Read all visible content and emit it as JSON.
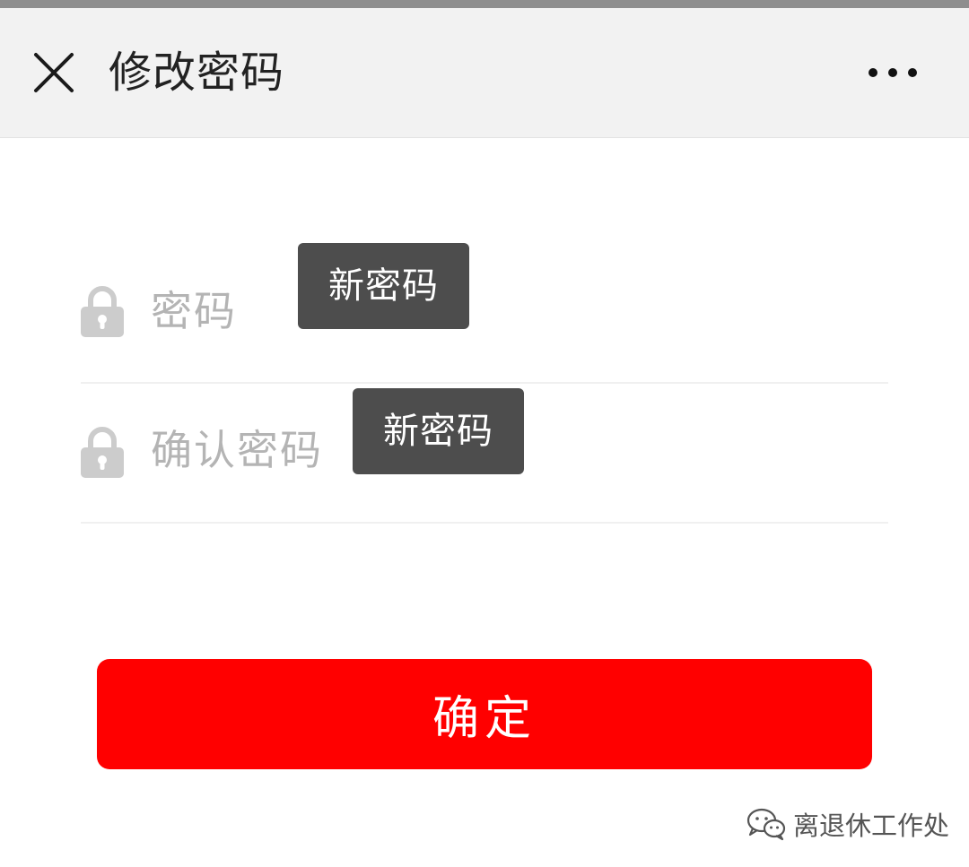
{
  "header": {
    "title": "修改密码",
    "close_icon": "close-icon",
    "more_icon": "more-dots-icon"
  },
  "form": {
    "password": {
      "placeholder": "密码",
      "value": "",
      "icon": "lock-icon",
      "tooltip": "新密码"
    },
    "confirm_password": {
      "placeholder": "确认密码",
      "value": "",
      "icon": "lock-icon",
      "tooltip": "新密码"
    }
  },
  "submit": {
    "label": "确定"
  },
  "watermark": {
    "text": "离退休工作处",
    "icon": "wechat-icon"
  },
  "colors": {
    "nav_background": "#f2f2f2",
    "primary_button": "#ff0000",
    "tooltip_background": "#4d4d4d",
    "placeholder_text": "#b4b4b4",
    "lock_icon": "#cccccc"
  }
}
